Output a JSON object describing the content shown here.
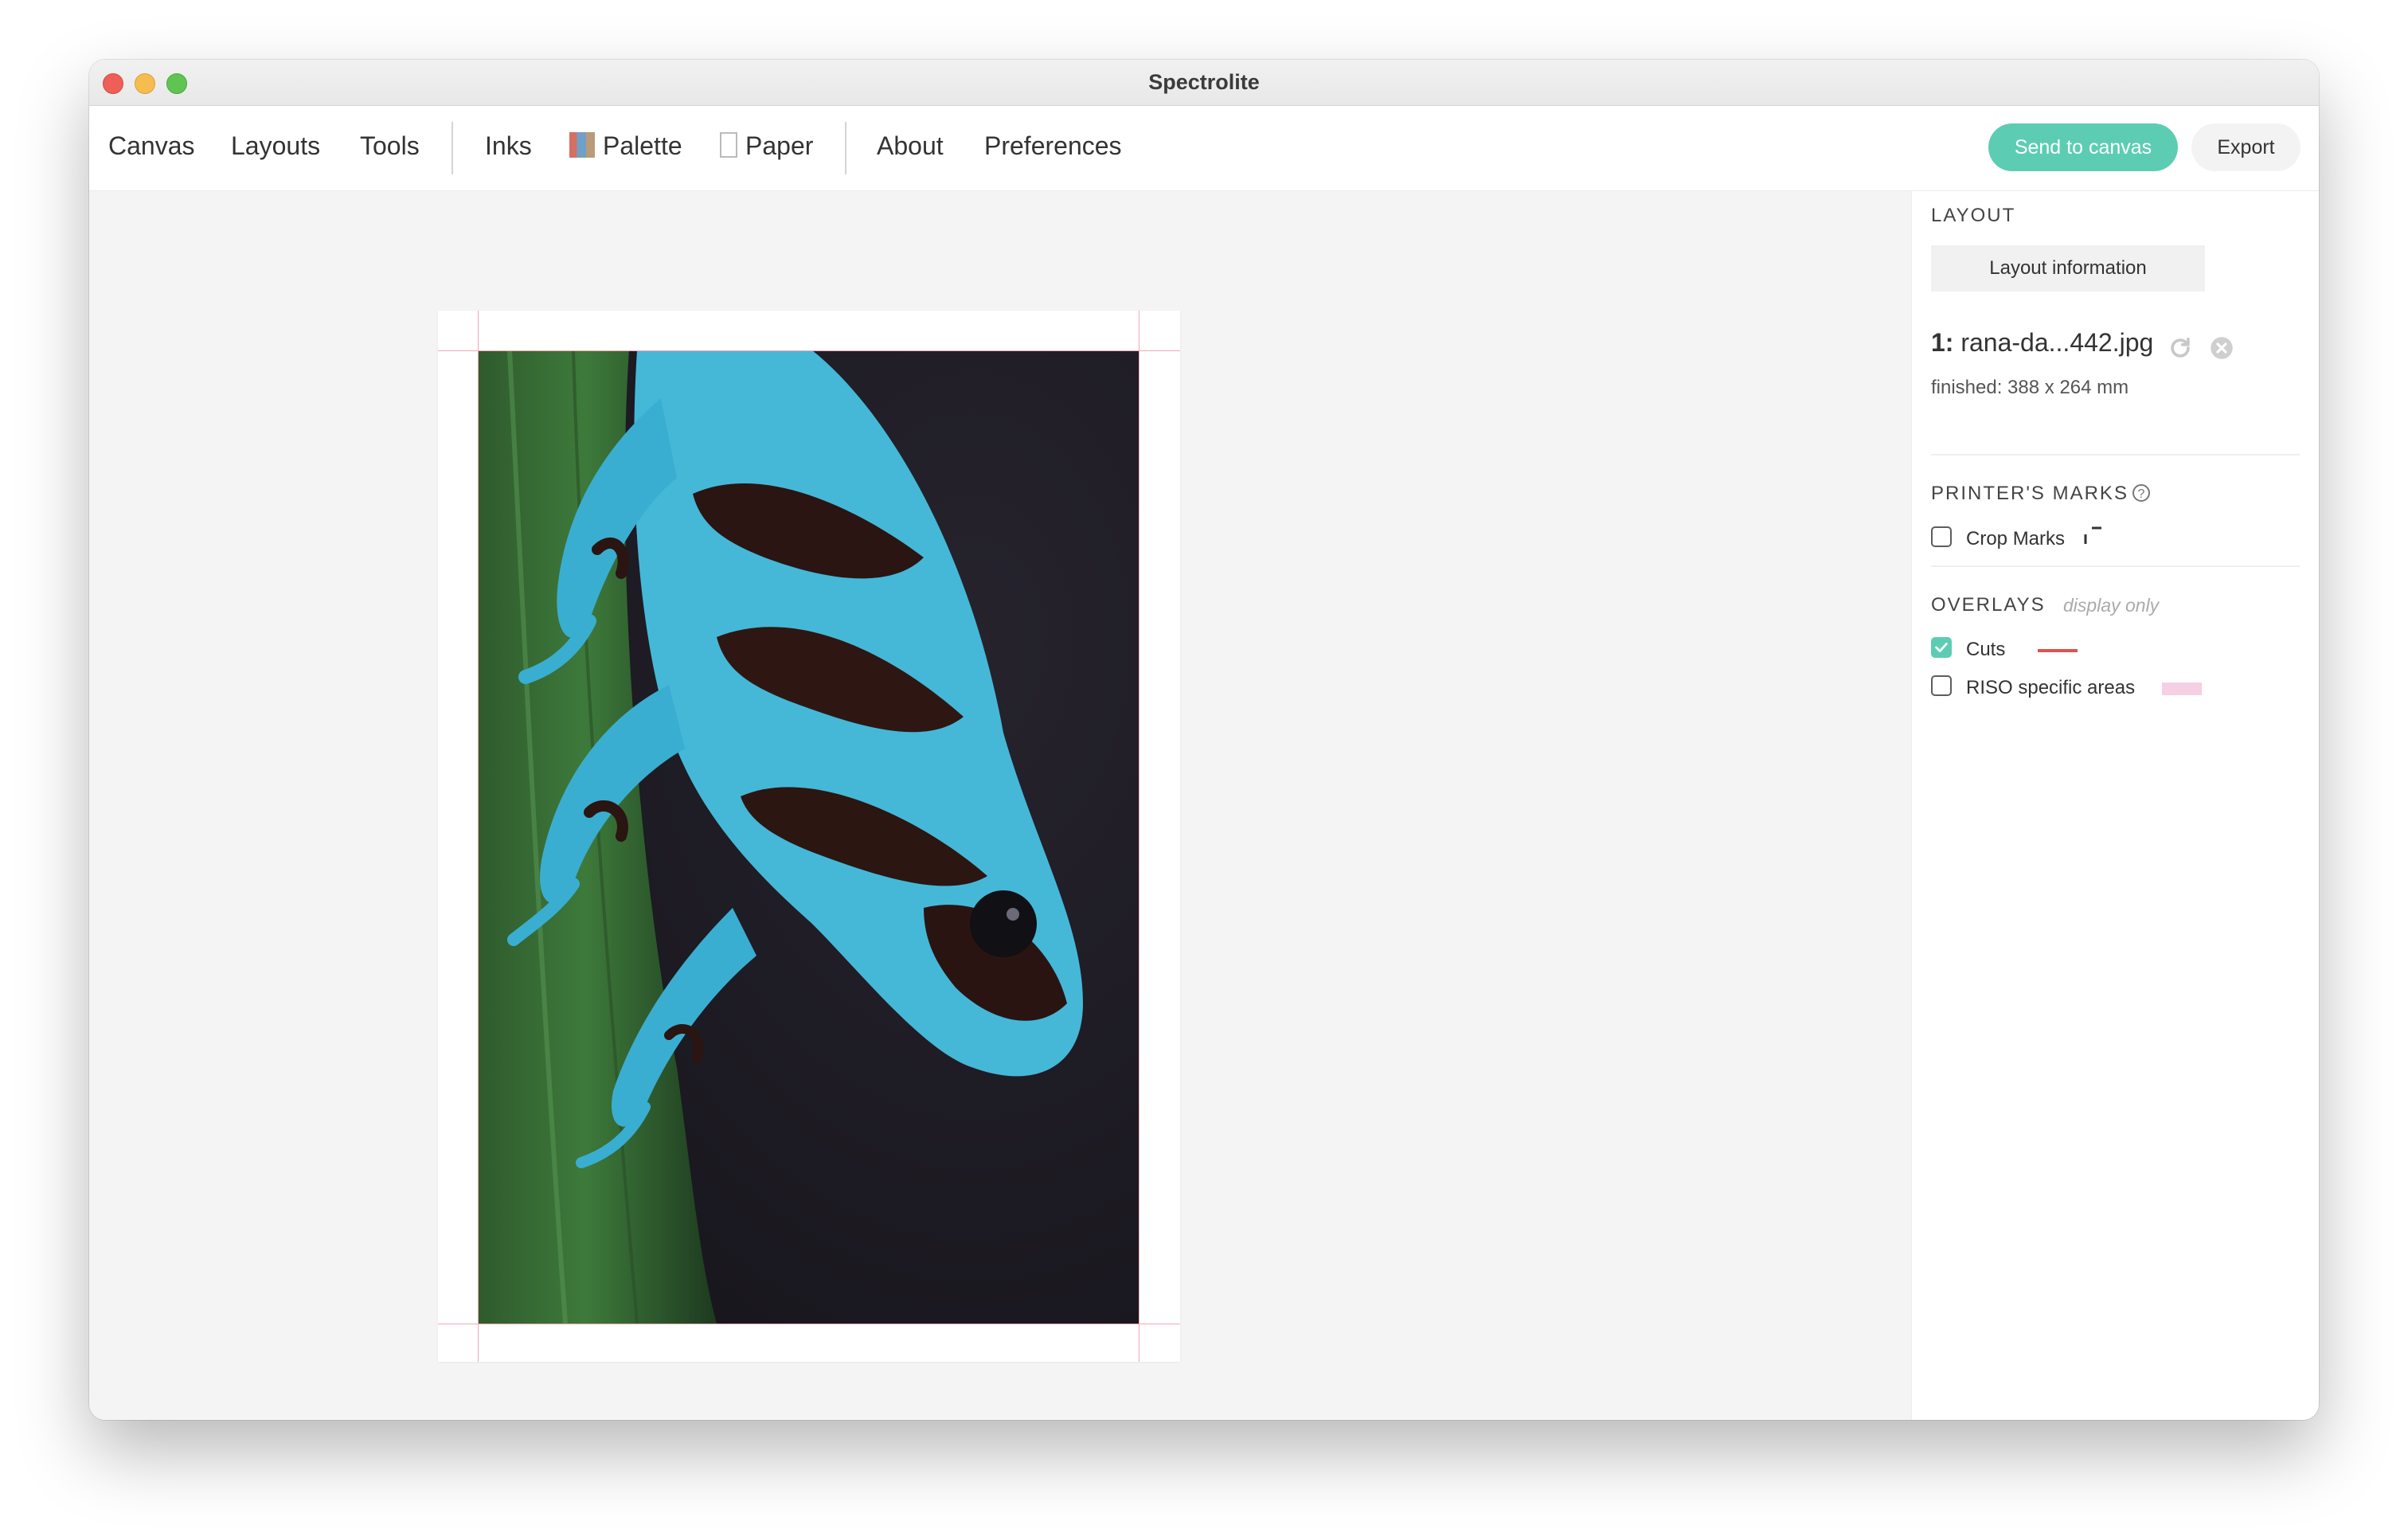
{
  "window": {
    "title": "Spectrolite"
  },
  "menu": {
    "canvas": "Canvas",
    "layouts": "Layouts",
    "tools": "Tools",
    "inks": "Inks",
    "palette": "Palette",
    "paper": "Paper",
    "about": "About",
    "preferences": "Preferences"
  },
  "toolbar": {
    "send": "Send to canvas",
    "export": "Export"
  },
  "sidebar": {
    "layout_title": "LAYOUT",
    "layout_info_button": "Layout information",
    "file": {
      "index": "1:",
      "name": "rana-da...442.jpg"
    },
    "finished": "finished: 388 x 264 mm",
    "marks_title": "PRINTER'S MARKS",
    "crop_marks": {
      "label": "Crop Marks",
      "checked": false
    },
    "overlays_title": "OVERLAYS",
    "overlays_hint": "display only",
    "cuts": {
      "label": "Cuts",
      "checked": true,
      "color": "#e0524f"
    },
    "riso": {
      "label": "RISO specific areas",
      "checked": false,
      "color": "#f5d0e4"
    }
  },
  "colors": {
    "accent": "#5ccdb2",
    "guide": "#f2a8b6"
  },
  "icons": [
    "refresh-icon",
    "remove-icon",
    "help-icon",
    "check-icon",
    "crop-mark-icon"
  ]
}
